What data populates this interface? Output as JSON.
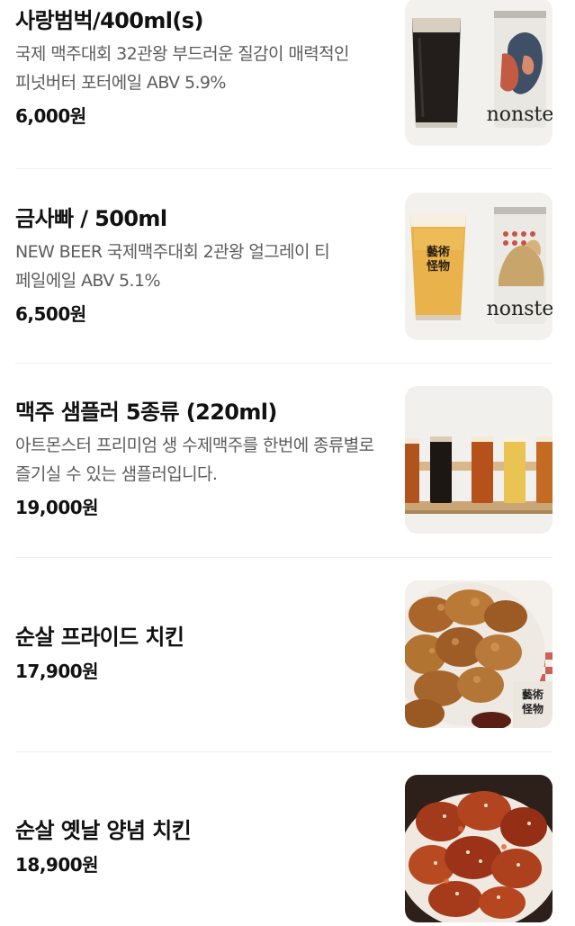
{
  "menu": [
    {
      "name": "사랑범벅/400ml(s)",
      "description": "국제 맥주대회 32관왕 부드러운 질감이 매력적인 피넛버터 포터에일 ABV 5.9%",
      "price": "6,000원",
      "image": "dark-porter-glass-and-can",
      "can_text": "nonste"
    },
    {
      "name": "금사빠 / 500ml",
      "description": "NEW BEER 국제맥주대회 2관왕 얼그레이 티 페일에일 ABV 5.1%",
      "price": "6,500원",
      "image": "pale-ale-glass-and-can",
      "glass_logo_line1": "藝術",
      "glass_logo_line2": "怪物",
      "can_text": "nonste"
    },
    {
      "name": "맥주 샘플러 5종류 (220ml)",
      "description": "아트몬스터 프리미엄 생 수제맥주를 한번에 종류별로 즐기실 수 있는 샘플러입니다.",
      "price": "19,000원",
      "image": "beer-sampler-flight"
    },
    {
      "name": "순살 프라이드 치킨",
      "price": "17,900원",
      "image": "boneless-fried-chicken",
      "card_line1": "藝術",
      "card_line2": "怪物"
    },
    {
      "name": "순살 옛날 양념 치킨",
      "price": "18,900원",
      "image": "boneless-seasoned-chicken"
    }
  ],
  "colors": {
    "porter": "#1e1a17",
    "foam": "#d7cdbf",
    "pale_ale": "#e8b148",
    "fried_chicken": "#a8682a",
    "seasoned_chicken": "#a2341a"
  }
}
